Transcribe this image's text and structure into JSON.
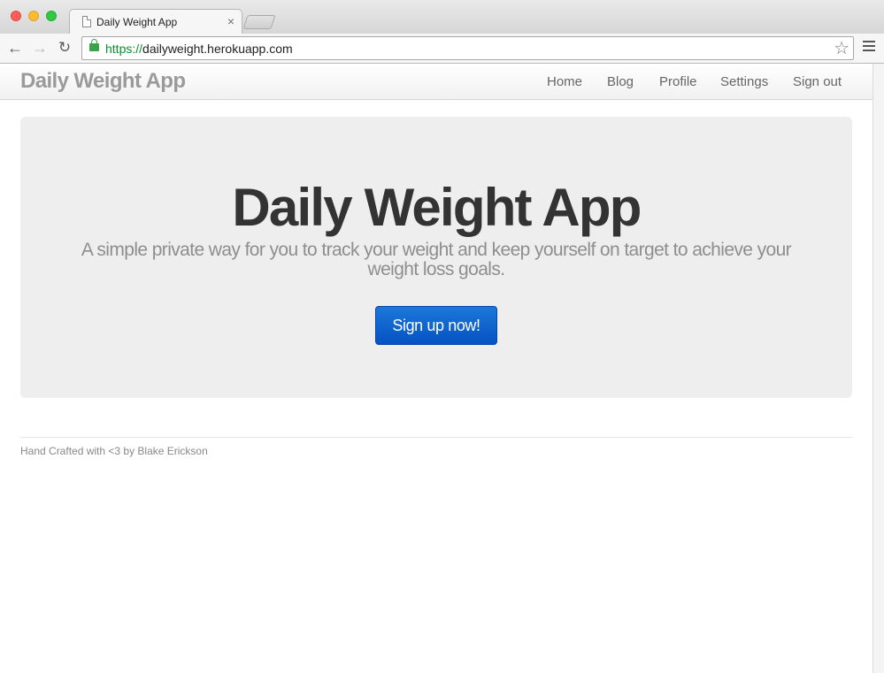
{
  "browser": {
    "tab_title": "Daily Weight App",
    "tab_close": "×",
    "url_scheme": "https://",
    "url_host": "dailyweight.herokuapp.com",
    "icons": [
      "back-arrow-icon",
      "forward-arrow-icon",
      "reload-icon",
      "lock-icon",
      "star-icon",
      "menu-icon",
      "document-icon"
    ]
  },
  "navbar": {
    "brand": "Daily Weight App",
    "links": [
      "Home",
      "Blog",
      "Profile",
      "Settings",
      "Sign out"
    ]
  },
  "hero": {
    "title": "Daily Weight App",
    "subtitle": "A simple private way for you to track your weight and keep yourself on target to achieve your weight loss goals.",
    "button_label": "Sign up now!"
  },
  "footer": {
    "text": "Hand Crafted with <3 by Blake Erickson"
  },
  "colors": {
    "primary_button": "#0a5fcf",
    "hero_background": "#eeeeee",
    "brand_text": "#9a9a9a"
  }
}
